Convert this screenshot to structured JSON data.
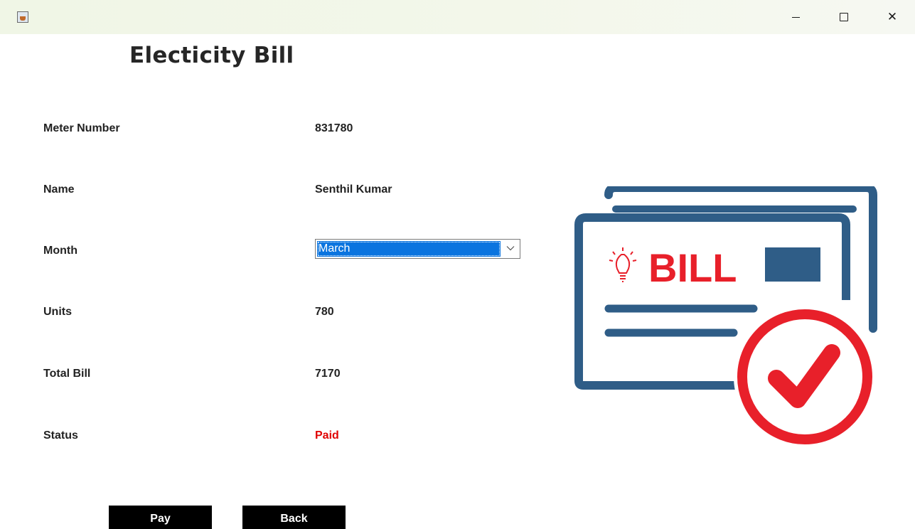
{
  "window": {
    "icon": "java-icon",
    "controls": {
      "minimize": "minimize-icon",
      "maximize": "maximize-icon",
      "close": "close-icon"
    }
  },
  "page": {
    "title": "Electicity Bill"
  },
  "fields": {
    "meter_number": {
      "label": "Meter Number",
      "value": "831780"
    },
    "name": {
      "label": "Name",
      "value": "Senthil Kumar"
    },
    "month": {
      "label": "Month",
      "selected": "March"
    },
    "units": {
      "label": "Units",
      "value": "780"
    },
    "total_bill": {
      "label": "Total Bill",
      "value": "7170"
    },
    "status": {
      "label": "Status",
      "value": "Paid"
    }
  },
  "buttons": {
    "pay": "Pay",
    "back": "Back"
  },
  "illustration": {
    "text": "BILL",
    "icon": "bill-paid-icon"
  },
  "colors": {
    "accent_red": "#e8202a",
    "bill_blue": "#2f5d87",
    "status_paid": "#e00000",
    "select_highlight": "#0a74df"
  }
}
